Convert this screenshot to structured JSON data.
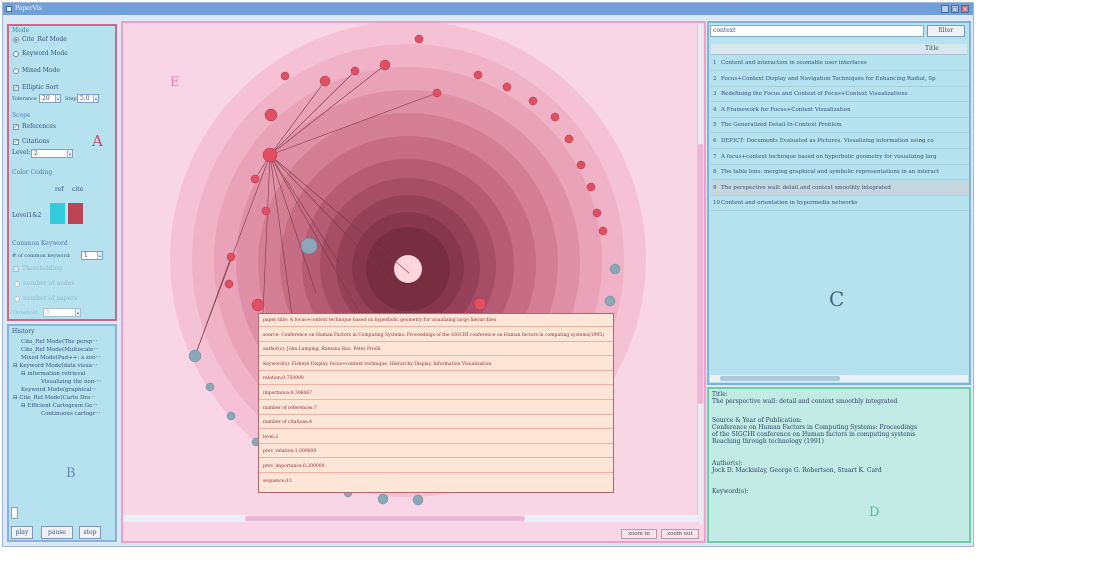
{
  "window": {
    "title": "PaperVis"
  },
  "panelA": {
    "mode_label": "Mode",
    "modes": [
      "Cite_Ref Mode",
      "Keyword Mode",
      "Mixed Mode"
    ],
    "selected_mode": 0,
    "elliptic_label": "Elliptic Sort",
    "tolerance_label": "Tolerance",
    "tolerance_value": "20",
    "step_label": "Step",
    "step_value": "5.0",
    "scope_label": "Scope",
    "references_label": "References",
    "citations_label": "Citations",
    "level_label": "Level:",
    "level_value": "2",
    "color_coding_label": "Color Coding",
    "ref_col": "ref",
    "cite_col": "cite",
    "level_row_label": "Level1&2",
    "ref_color": "#33ccdd",
    "cite_color": "#bb4455",
    "common_keyword_label": "Common Keyword",
    "num_common_keyword_label": "# of common keyword:",
    "num_common_keyword_value": "1",
    "thresholding_label": "Thresholding",
    "num_nodes_label": "number of nodes",
    "num_papers_label": "number of papers",
    "threshold_label": "Threshold:",
    "threshold_value": "5",
    "panel_letter": "A"
  },
  "panelB": {
    "history_label": "History",
    "history_items": [
      "Cite_Ref Mode(The persp···",
      "Cite_Ref Mode(Multiscale···",
      "Mixed Mode(Pad++: a zoo···",
      "Keyword Mode(data visua···",
      "information retrieval",
      "Visualizing the non-···",
      "Keyword Mode(graphical···",
      "Cite_Ref Mode(Carto Dra···",
      "Efficient Cartogram Ge···",
      "Continuous cartogr···"
    ],
    "play_label": "play",
    "pause_label": "pause",
    "stop_label": "stop",
    "panel_letter": "B"
  },
  "panelE": {
    "panel_letter": "E",
    "zoom_in_label": "zoom in",
    "zoom_out_label": "zoom out",
    "info_rows": [
      "paper title: A focus+context technique based on hyperbolic geometry for visualizing large hierarchies",
      "source: Conference on Human Factors in Computing Systems: Proceedings of the SIGCHI conference on Human factors in computing systems(1995)",
      "author(s): John Lamping, Ramana Rao, Peter Pirolli",
      "Keyword(s): Fisheye Display, focus+context technique, Hierarchy Display, Information Visualization",
      "relation:0.750000",
      "importance:0.306667",
      "number of references:7",
      "number of citations:4",
      "level:2",
      "prev_relation:1.000000",
      "prev_importance:0.200000",
      "sequence:13"
    ]
  },
  "panelC": {
    "search_value": "context",
    "search_button": "filter",
    "title_header": "Title",
    "rows": [
      {
        "n": "1",
        "title": "Content and interaction in zoomable user interfaces"
      },
      {
        "n": "2",
        "title": "Focus+Context Display and Navigation Techniques for Enhancing Radial, Sp"
      },
      {
        "n": "3",
        "title": "Redefining the Focus and Context of Focus+Context Visualizations"
      },
      {
        "n": "4",
        "title": "A Framework for Focus+Context Visualization"
      },
      {
        "n": "5",
        "title": "The Generalized Detail-In-Context Problem"
      },
      {
        "n": "6",
        "title": "DEPICT: Documents Evaluated as Pictures. Visualizing information using co"
      },
      {
        "n": "7",
        "title": "A focus+context technique based on hyperbolic geometry for visualizing larg"
      },
      {
        "n": "8",
        "title": "The table lens: merging graphical and symbolic representations in an interact"
      },
      {
        "n": "9",
        "title": "The perspective wall: detail and context smoothly integrated"
      },
      {
        "n": "10",
        "title": "Content and orientation in hypermedia networks"
      }
    ],
    "selected_row": 8,
    "panel_letter": "C"
  },
  "panelD": {
    "title_label": "Title:",
    "title_value": "The perspective wall: detail and context smoothly integrated",
    "source_label": "Source & Year of Publication:",
    "source_lines": [
      "Conference on Human Factors in Computing Systems: Proceedings",
      "of the SIGCHI conference on Human factors in computing systems",
      "Reaching through technology   (1991)"
    ],
    "authors_label": "Author(s):",
    "authors_value": "Jock D. Mackinlay, George G. Robertson, Stuart K. Card",
    "keywords_label": "Keyword(s):",
    "panel_letter": "D"
  },
  "colors": {
    "red_node": "#e05062",
    "gray_node": "#8aa8b8",
    "center_node": "#ffd6dc"
  }
}
